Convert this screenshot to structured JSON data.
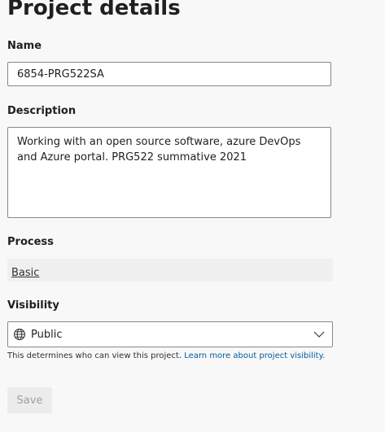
{
  "page": {
    "title": "Project details"
  },
  "name": {
    "label": "Name",
    "value": "6854-PRG522SA"
  },
  "description": {
    "label": "Description",
    "value": "Working with an open source software, azure DevOps and Azure portal. PRG522 summative 2021"
  },
  "process": {
    "label": "Process",
    "value": "Basic"
  },
  "visibility": {
    "label": "Visibility",
    "value": "Public",
    "icon": "globe-icon",
    "help_text": "This determines who can view this project.",
    "help_link": "Learn more about project visibility."
  },
  "actions": {
    "save_label": "Save"
  },
  "colors": {
    "link": "#005a9e",
    "disabled_text": "#a19f9d"
  }
}
